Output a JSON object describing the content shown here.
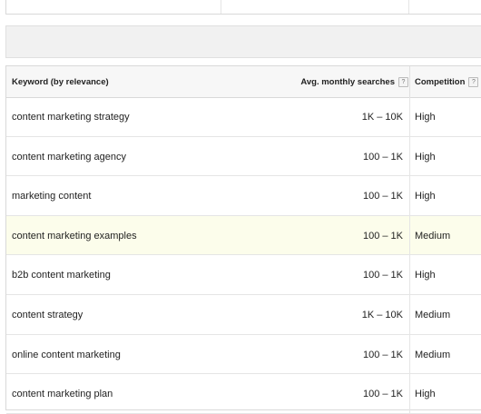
{
  "header": {
    "keyword_label": "Keyword (by relevance)",
    "avg_label": "Avg. monthly searches",
    "competition_label": "Competition",
    "help_glyph": "?"
  },
  "rows": [
    {
      "keyword": "content marketing strategy",
      "avg": "1K – 10K",
      "competition": "High"
    },
    {
      "keyword": "content marketing agency",
      "avg": "100 – 1K",
      "competition": "High"
    },
    {
      "keyword": "marketing content",
      "avg": "100 – 1K",
      "competition": "High"
    },
    {
      "keyword": "content marketing examples",
      "avg": "100 – 1K",
      "competition": "Medium",
      "highlighted": true
    },
    {
      "keyword": "b2b content marketing",
      "avg": "100 – 1K",
      "competition": "High"
    },
    {
      "keyword": "content strategy",
      "avg": "1K – 10K",
      "competition": "Medium"
    },
    {
      "keyword": "online content marketing",
      "avg": "100 – 1K",
      "competition": "Medium"
    },
    {
      "keyword": "content marketing plan",
      "avg": "100 – 1K",
      "competition": "High"
    }
  ],
  "colors": {
    "highlight_row": "#fcfdeb",
    "header_bg": "#f7f7f7",
    "band_bg": "#f1f1f1"
  }
}
